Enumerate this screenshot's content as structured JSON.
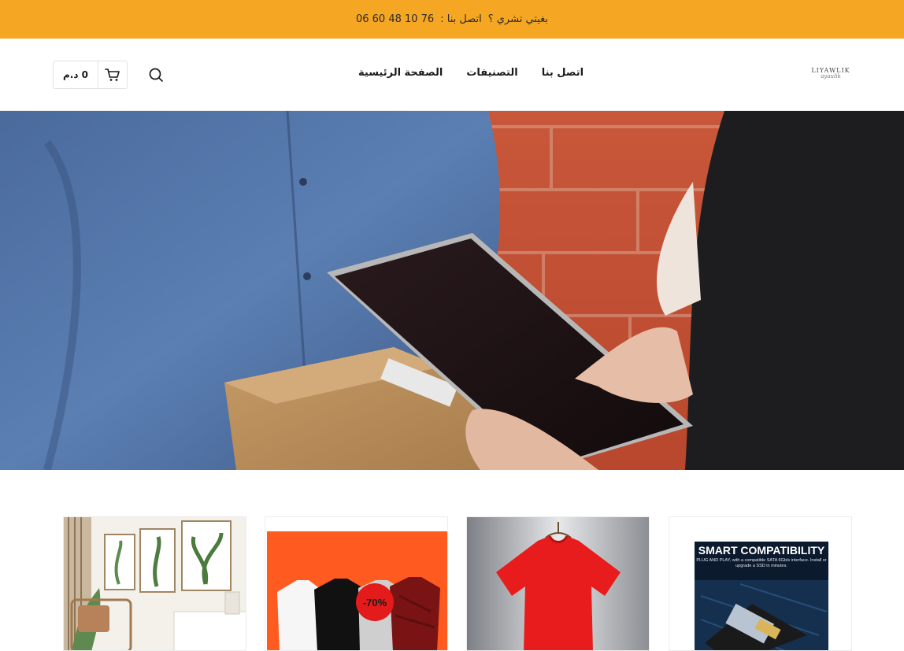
{
  "topbar": {
    "question": "بغيتي تشري ؟",
    "contact_label": "اتصل بنا :",
    "phone": "06 60 48 10 76"
  },
  "header": {
    "logo": {
      "text": "LIYAWLIK",
      "script": "ayaulik"
    },
    "nav": [
      {
        "label": "الصفحة الرئيسية"
      },
      {
        "label": "التصنيفات"
      },
      {
        "label": "اتصل بنا"
      }
    ],
    "cart": {
      "total": "0 د.م",
      "icon": "cart-icon"
    },
    "search": {
      "icon": "search-icon"
    }
  },
  "hero": {
    "image": "delivery-courier-tablet-photo"
  },
  "categories": [
    {
      "image": "home-decor-photo"
    },
    {
      "image": "thermal-shirts-sale",
      "badge": "-70%"
    },
    {
      "image": "red-tshirt-photo"
    },
    {
      "image": "ssd-drive-photo",
      "title": "SMART COMPATIBILITY",
      "subtitle": "PLUG AND PLAY, with a compatible SATA 6Gb/s interface. Install or upgrade a SSD in minutes."
    }
  ],
  "colors": {
    "accent": "#f5a623",
    "sale_badge": "#e31b1b"
  }
}
